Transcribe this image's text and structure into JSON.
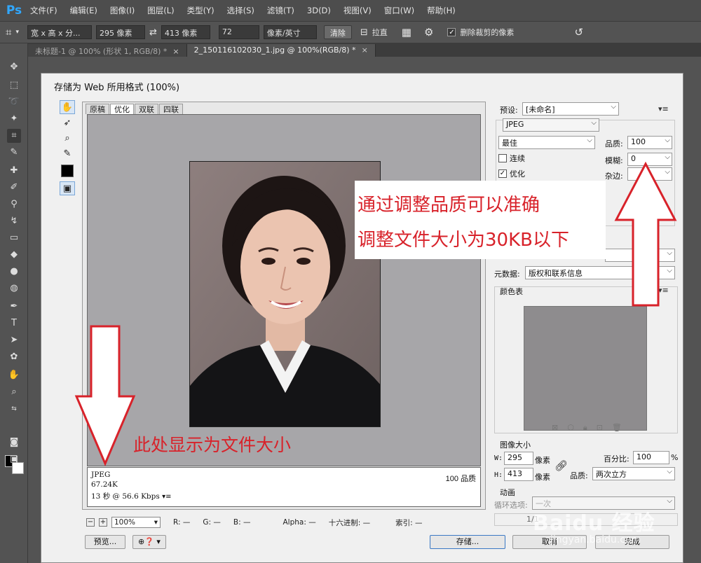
{
  "app": {
    "logo": "Ps"
  },
  "menu": [
    "文件(F)",
    "编辑(E)",
    "图像(I)",
    "图层(L)",
    "类型(Y)",
    "选择(S)",
    "滤镜(T)",
    "3D(D)",
    "视图(V)",
    "窗口(W)",
    "帮助(H)"
  ],
  "options": {
    "ratio": "宽 x 高 x 分...",
    "width": "295 像素",
    "height": "413 像素",
    "resolution": "72",
    "unit": "像素/英寸",
    "clear": "清除",
    "straighten": "拉直",
    "delete_cropped": "删除裁剪的像素"
  },
  "doc_tabs": [
    {
      "label": "未标题-1 @ 100% (形状 1, RGB/8) *"
    },
    {
      "label": "2_150116102030_1.jpg @ 100%(RGB/8) *"
    }
  ],
  "dialog": {
    "title": "存储为 Web 所用格式 (100%)",
    "view_tabs": [
      "原稿",
      "优化",
      "双联",
      "四联"
    ],
    "info": {
      "format": "JPEG",
      "size": "67.24K",
      "time": "13 秒 @ 56.6 Kbps",
      "quality": "100 品质"
    },
    "status": {
      "zoom": "100%",
      "r": "R: —",
      "g": "G: —",
      "b": "B: —",
      "alpha": "Alpha: —",
      "hex": "十六进制: —",
      "index": "索引: —"
    },
    "buttons": {
      "preview": "预览...",
      "save": "存储...",
      "cancel": "取消",
      "done": "完成"
    },
    "settings": {
      "preset_label": "预设:",
      "preset_value": "[未命名]",
      "format": "JPEG",
      "quality_preset": "最佳",
      "quality_label": "品质:",
      "quality_value": "100",
      "blur_label": "模糊:",
      "blur_value": "0",
      "matte_label": "杂边:",
      "progressive": "连续",
      "optimized": "优化",
      "metadata_label": "元数据:",
      "metadata_value": "版权和联系信息",
      "color_table": "颜色表",
      "image_size": "图像大小",
      "w_label": "W:",
      "w_value": "295",
      "h_label": "H:",
      "h_value": "413",
      "px": "像素",
      "percent_label": "百分比:",
      "percent_value": "100",
      "percent_unit": "%",
      "resample_label": "品质:",
      "resample_value": "两次立方",
      "animation": "动画",
      "loop_label": "循环选项:",
      "loop_value": "一次",
      "frame": "1/1"
    }
  },
  "annotations": {
    "line1": "通过调整品质可以准确",
    "line2": "调整文件大小为30KB以下",
    "bottom": "此处显示为文件大小"
  },
  "watermark": {
    "main": "Baidu 经验",
    "sub": "jingyan.baidu.com"
  },
  "colors": {
    "ps_blue": "#31a8ff",
    "annotation_red": "#d8222a",
    "canvas_gray": "#a7a6a9"
  }
}
